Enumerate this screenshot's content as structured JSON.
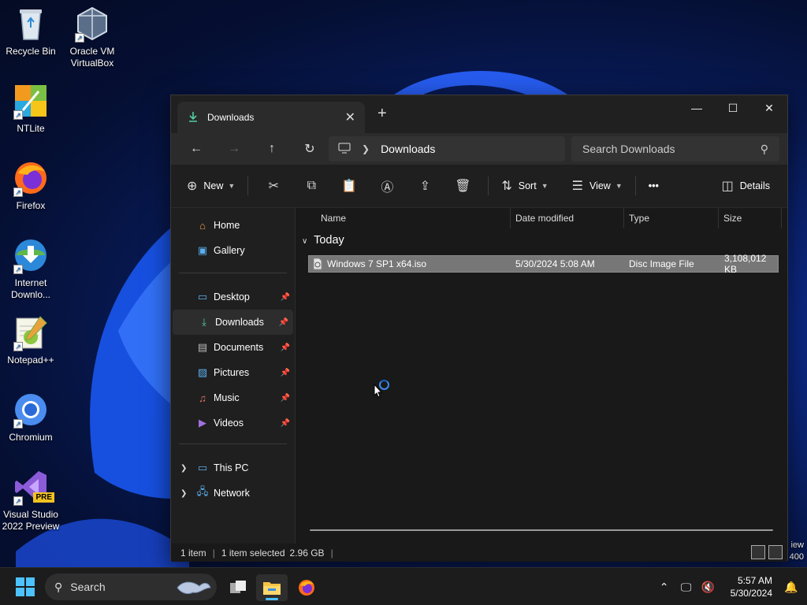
{
  "desktop": {
    "icons": [
      {
        "label": "Recycle Bin"
      },
      {
        "label": "Oracle VM VirtualBox"
      },
      {
        "label": "NTLite"
      },
      {
        "label": "Firefox"
      },
      {
        "label": "Internet Downlo..."
      },
      {
        "label": "Notepad++"
      },
      {
        "label": "Chromium"
      },
      {
        "label": "Visual Studio 2022 Preview"
      }
    ],
    "vs_badge": "PRE",
    "behind_window_text": [
      "iew",
      "400"
    ]
  },
  "explorer": {
    "tab_title": "Downloads",
    "breadcrumb": "Downloads",
    "search_placeholder": "Search Downloads",
    "commands": {
      "new": "New",
      "sort": "Sort",
      "view": "View",
      "more": "•••",
      "details": "Details"
    },
    "nav": {
      "top": [
        {
          "label": "Home",
          "icon": "home-icon"
        },
        {
          "label": "Gallery",
          "icon": "gallery-icon"
        }
      ],
      "pinned": [
        {
          "label": "Desktop",
          "icon": "desktop-folder-icon"
        },
        {
          "label": "Downloads",
          "icon": "downloads-icon",
          "selected": true
        },
        {
          "label": "Documents",
          "icon": "documents-icon"
        },
        {
          "label": "Pictures",
          "icon": "pictures-icon"
        },
        {
          "label": "Music",
          "icon": "music-icon"
        },
        {
          "label": "Videos",
          "icon": "videos-icon"
        }
      ],
      "bottom": [
        {
          "label": "This PC",
          "icon": "this-pc-icon"
        },
        {
          "label": "Network",
          "icon": "network-icon"
        }
      ]
    },
    "columns": {
      "name": "Name",
      "date": "Date modified",
      "type": "Type",
      "size": "Size"
    },
    "group_label": "Today",
    "files": [
      {
        "name": "Windows 7 SP1 x64.iso",
        "date": "5/30/2024 5:08 AM",
        "type": "Disc Image File",
        "size": "3,108,012 KB"
      }
    ],
    "status": {
      "count": "1 item",
      "selection": "1 item selected",
      "selection_size": "2.96 GB"
    }
  },
  "taskbar": {
    "search_label": "Search",
    "time": "5:57 AM",
    "date": "5/30/2024"
  },
  "colors": {
    "accent": "#4cc2ff",
    "window_bg": "#191919",
    "selection": "#777777"
  }
}
